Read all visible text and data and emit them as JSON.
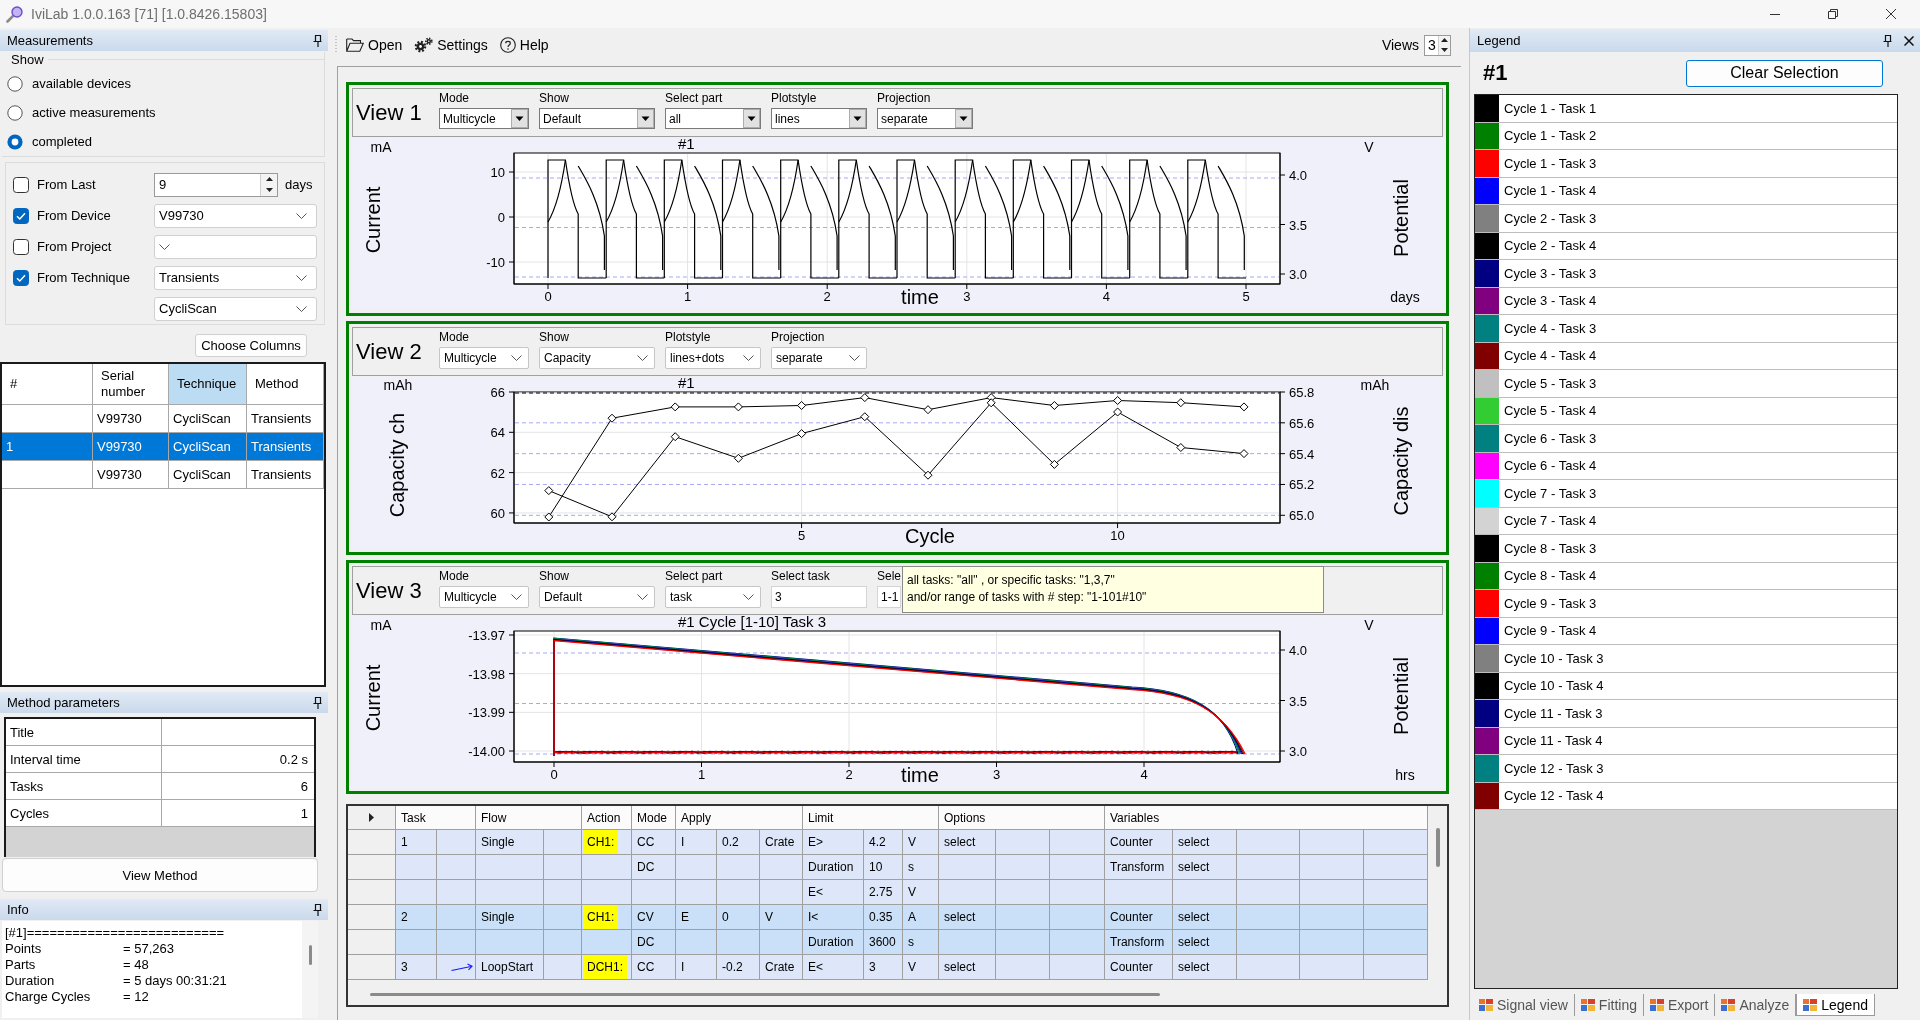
{
  "window": {
    "title": "IviLab 1.0.0.163 [71] [1.0.8426.15803]"
  },
  "measurements": {
    "title": "Measurements",
    "show": {
      "label": "Show",
      "options": [
        {
          "label": "available devices",
          "selected": false
        },
        {
          "label": "active measurements",
          "selected": false
        },
        {
          "label": "completed",
          "selected": true
        }
      ]
    },
    "filters": [
      {
        "label": "From Last",
        "checked": false,
        "fields": [
          {
            "kind": "number",
            "value": "9",
            "suffix": "days"
          }
        ]
      },
      {
        "label": "From Device",
        "checked": true,
        "fields": [
          {
            "kind": "dropdown",
            "value": "V99730"
          }
        ]
      },
      {
        "label": "From Project",
        "checked": false,
        "fields": [
          {
            "kind": "dropdown"
          }
        ]
      },
      {
        "label": "From Technique",
        "checked": true,
        "fields": [
          {
            "kind": "dropdown",
            "value": "Transients"
          },
          {
            "kind": "dropdown",
            "value": "CycliScan"
          }
        ]
      }
    ],
    "choose_columns": "Choose Columns",
    "table": {
      "columns": [
        {
          "label": "#",
          "selected": false
        },
        {
          "label": "Serial number",
          "selected": false
        },
        {
          "label": "Technique",
          "selected": true
        },
        {
          "label": "Method",
          "selected": false
        }
      ],
      "rows": [
        {
          "selected": false,
          "cells": [
            null,
            "V99730",
            "CycliScan",
            "Transients"
          ]
        },
        {
          "selected": true,
          "cells": [
            "1",
            "V99730",
            "CycliScan",
            "Transients"
          ]
        },
        {
          "selected": false,
          "cells": [
            null,
            "V99730",
            "CycliScan",
            "Transients"
          ]
        }
      ]
    }
  },
  "method_parameters": {
    "title": "Method parameters",
    "rows": [
      {
        "name": "Title"
      },
      {
        "name": "Interval time",
        "value": "0.2 s"
      },
      {
        "name": "Tasks",
        "value": "6"
      },
      {
        "name": "Cycles",
        "value": "1"
      }
    ],
    "button": "View Method"
  },
  "info": {
    "title": "Info",
    "header": "[#1]==========================",
    "lines": [
      {
        "key": "Points",
        "value": "= 57,263"
      },
      {
        "key": "Parts",
        "value": "= 48"
      },
      {
        "key": "Duration",
        "value": "= 5 days 00:31:21"
      },
      {
        "key": "Charge Cycles",
        "value": "= 12"
      }
    ]
  },
  "toolbar": {
    "items": [
      {
        "kind": "open",
        "label": "Open"
      },
      {
        "kind": "settings",
        "label": "Settings"
      },
      {
        "kind": "help",
        "label": "Help"
      }
    ],
    "views": {
      "label": "Views",
      "value": "3"
    }
  },
  "views": [
    {
      "title": "View 1",
      "controls": [
        {
          "kind": "combo",
          "label": "Mode",
          "value": "Multicycle"
        },
        {
          "kind": "combo",
          "label": "Show",
          "value": "Default"
        },
        {
          "kind": "combo",
          "label": "Select part",
          "value": "all"
        },
        {
          "kind": "combo",
          "label": "Plotstyle",
          "value": "lines"
        },
        {
          "kind": "combo",
          "label": "Projection",
          "value": "separate"
        }
      ],
      "plot": {
        "kind": "cycling",
        "title": "#1",
        "ylabel": "Current",
        "yunit": "mA",
        "yticks": [
          "10",
          "0",
          "-10"
        ],
        "y2label": "Potential",
        "y2unit": "V",
        "y2ticks": [
          "4.0",
          "3.5",
          "3.0"
        ],
        "xlabel": "time",
        "xunit": "days",
        "xticks": [
          "0",
          "1",
          "2",
          "3",
          "4",
          "5"
        ]
      }
    },
    {
      "title": "View 2",
      "controls": [
        {
          "kind": "dropdown",
          "label": "Mode",
          "value": "Multicycle"
        },
        {
          "kind": "dropdown",
          "label": "Show",
          "value": "Capacity"
        },
        {
          "kind": "dropdown",
          "label": "Plotstyle",
          "value": "lines+dots"
        },
        {
          "kind": "dropdown",
          "label": "Projection",
          "value": "separate"
        }
      ],
      "plot": {
        "kind": "capacity",
        "yunit": "mAh",
        "y2unit": "mAh",
        "chart_data": {
          "type": "line",
          "title": "#1",
          "xlabel": "Cycle",
          "ylabel": "Capacity dis",
          "x": [
            1,
            2,
            3,
            4,
            5,
            6,
            7,
            8,
            9,
            10,
            11,
            12
          ],
          "series": [
            {
              "color": "#000000",
              "marker": "diamond",
              "axis": "y2",
              "values": [
                59.8,
                64.7,
                65.26,
                65.26,
                65.33,
                65.72,
                65.12,
                65.72,
                65.33,
                65.58,
                65.47,
                65.26
              ]
            },
            {
              "color": "#000000",
              "marker": "diamond",
              "values": [
                65.16,
                64.99,
                65.51,
                65.37,
                65.53,
                65.64,
                65.26,
                65.73,
                65.33,
                65.67,
                65.44,
                65.4
              ]
            }
          ],
          "xlim": [
            0.45,
            12.57
          ],
          "ylim": [
            64.95,
            65.8
          ],
          "xticks": [
            5,
            10
          ],
          "yticks": [
            {
              "value": 65,
              "label": "65.0"
            },
            65.2,
            65.4,
            65.6,
            65.8
          ],
          "y2label": "Capacity ch",
          "y2lim": [
            59.5,
            66
          ],
          "y2ticks": [
            60,
            62,
            64,
            66
          ],
          "grid": true
        }
      }
    },
    {
      "title": "View 3",
      "controls": [
        {
          "kind": "dropdown",
          "label": "Mode",
          "value": "Multicycle"
        },
        {
          "kind": "dropdown",
          "label": "Show",
          "value": "Default"
        },
        {
          "kind": "dropdown",
          "label": "Select part",
          "value": "task"
        },
        {
          "kind": "textbox",
          "label": "Select task",
          "value": "3"
        },
        {
          "kind": "textbox",
          "label": "Sele",
          "value": "1-1"
        }
      ],
      "tooltip": [
        "all tasks: \"all\" , or specific tasks: \"1,3,7\"",
        "and/or range of tasks with # step: \"1-101#10\""
      ],
      "plot": {
        "kind": "task",
        "title": "#1 Cycle [1-10] Task 3",
        "ylabel": "Current",
        "yunit": "mA",
        "yticks": [
          "-13.97",
          "-13.98",
          "-13.99",
          "-14.00"
        ],
        "y2label": "Potential",
        "y2unit": "V",
        "y2ticks": [
          "4.0",
          "3.5",
          "3.0"
        ],
        "xlabel": "time",
        "xunit": "hrs",
        "xticks": [
          "0",
          "1",
          "2",
          "3",
          "4"
        ]
      }
    }
  ],
  "method_table": {
    "columns": [
      "Task",
      null,
      "Flow",
      null,
      "Action",
      "Mode",
      "Apply",
      null,
      null,
      "Limit",
      null,
      null,
      "Options",
      null,
      null,
      "Variables",
      null,
      null,
      null,
      null
    ],
    "tasks": [
      {
        "rows": [
          {
            "loop_arrow": false,
            "cells": [
              "1",
              null,
              "Single",
              null,
              {
                "text": "CH1:",
                "kind": "channel"
              },
              "CC",
              "I",
              "0.2",
              "Crate",
              "E>",
              "4.2",
              "V",
              "select",
              null,
              null,
              "Counter",
              "select",
              null,
              null,
              null
            ]
          },
          {
            "loop_arrow": false,
            "cells": [
              null,
              null,
              null,
              null,
              null,
              "DC",
              null,
              null,
              null,
              "Duration",
              "10",
              "s",
              null,
              null,
              null,
              "Transform",
              "select",
              null,
              null,
              null
            ]
          },
          {
            "loop_arrow": false,
            "cells": [
              null,
              null,
              null,
              null,
              null,
              null,
              null,
              null,
              null,
              "E<",
              "2.75",
              "V",
              null,
              null,
              null,
              null,
              null,
              null,
              null,
              null
            ]
          }
        ]
      },
      {
        "rows": [
          {
            "loop_arrow": false,
            "cells": [
              "2",
              null,
              "Single",
              null,
              {
                "text": "CH1:",
                "kind": "channel"
              },
              "CV",
              "E",
              "0",
              "V",
              "I<",
              "0.35",
              "A",
              "select",
              null,
              null,
              "Counter",
              "select",
              null,
              null,
              null
            ]
          },
          {
            "loop_arrow": false,
            "cells": [
              null,
              null,
              null,
              null,
              null,
              "DC",
              null,
              null,
              null,
              "Duration",
              "3600",
              "s",
              null,
              null,
              null,
              "Transform",
              "select",
              null,
              null,
              null
            ]
          }
        ]
      },
      {
        "rows": [
          {
            "loop_arrow": true,
            "cells": [
              "3",
              null,
              "LoopStart",
              null,
              {
                "text": "DCH1:",
                "kind": "channel"
              },
              "CC",
              "I",
              "-0.2",
              "Crate",
              "E<",
              "3",
              "V",
              "select",
              null,
              null,
              "Counter",
              "select",
              null,
              null,
              null
            ]
          }
        ]
      }
    ]
  },
  "legend": {
    "title": "Legend",
    "heading": "#1",
    "clear_button": "Clear Selection",
    "items": [
      {
        "label": "Cycle 1 - Task 1",
        "color": "#000000"
      },
      {
        "label": "Cycle 1 - Task 2",
        "color": "#008000"
      },
      {
        "label": "Cycle 1 - Task 3",
        "color": "#ff0000"
      },
      {
        "label": "Cycle 1 - Task 4",
        "color": "#0000ff"
      },
      {
        "label": "Cycle 2 - Task 3",
        "color": "#808080"
      },
      {
        "label": "Cycle 2 - Task 4",
        "color": "#000000"
      },
      {
        "label": "Cycle 3 - Task 3",
        "color": "#000080"
      },
      {
        "label": "Cycle 3 - Task 4",
        "color": "#800080"
      },
      {
        "label": "Cycle 4 - Task 3",
        "color": "#008080"
      },
      {
        "label": "Cycle 4 - Task 4",
        "color": "#800000"
      },
      {
        "label": "Cycle 5 - Task 3",
        "color": "#c0c0c0"
      },
      {
        "label": "Cycle 5 - Task 4",
        "color": "#32cd32"
      },
      {
        "label": "Cycle 6 - Task 3",
        "color": "#008080"
      },
      {
        "label": "Cycle 6 - Task 4",
        "color": "#ff00ff"
      },
      {
        "label": "Cycle 7 - Task 3",
        "color": "#00ffff"
      },
      {
        "label": "Cycle 7 - Task 4",
        "color": "#d3d3d3"
      },
      {
        "label": "Cycle 8 - Task 3",
        "color": "#000000"
      },
      {
        "label": "Cycle 8 - Task 4",
        "color": "#008000"
      },
      {
        "label": "Cycle 9 - Task 3",
        "color": "#ff0000"
      },
      {
        "label": "Cycle 9 - Task 4",
        "color": "#0000ff"
      },
      {
        "label": "Cycle 10 - Task 3",
        "color": "#808080"
      },
      {
        "label": "Cycle 10 - Task 4",
        "color": "#000000"
      },
      {
        "label": "Cycle 11 - Task 3",
        "color": "#000080"
      },
      {
        "label": "Cycle 11 - Task 4",
        "color": "#800080"
      },
      {
        "label": "Cycle 12 - Task 3",
        "color": "#008080"
      },
      {
        "label": "Cycle 12 - Task 4",
        "color": "#800000"
      }
    ]
  },
  "bottom_tabs": [
    {
      "label": "Signal view",
      "selected": false
    },
    {
      "label": "Fitting",
      "selected": false
    },
    {
      "label": "Export",
      "selected": false
    },
    {
      "label": "Analyze",
      "selected": false
    },
    {
      "label": "Legend",
      "selected": true
    }
  ]
}
